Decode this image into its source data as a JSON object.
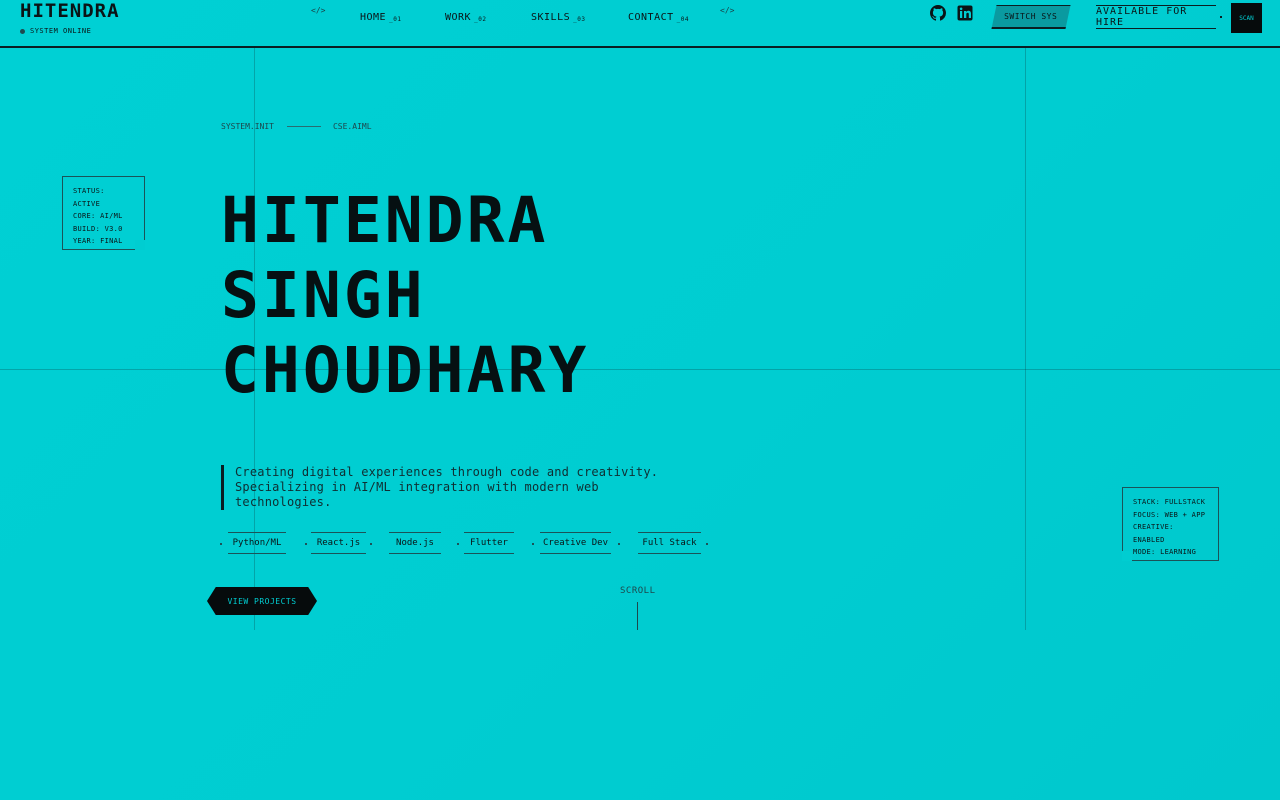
{
  "header": {
    "logo": "HITENDRA",
    "status": "SYSTEM ONLINE",
    "code_open": "</>",
    "code_close": "</>",
    "nav": [
      {
        "label": "HOME",
        "num": "_01"
      },
      {
        "label": "WORK",
        "num": "_02"
      },
      {
        "label": "SKILLS",
        "num": "_03"
      },
      {
        "label": "CONTACT",
        "num": "_04"
      }
    ],
    "social": [
      "github-icon",
      "linkedin-icon"
    ],
    "switch_label": "SWITCH SYS",
    "hire_label": "AVAILABLE FOR HIRE",
    "scan_label": "SCAN"
  },
  "hero": {
    "crumb_1": "SYSTEM.INIT",
    "crumb_2": "CSE.AIML",
    "name_line_1": "HITENDRA",
    "name_line_2": "SINGH",
    "name_line_3": "CHOUDHARY",
    "tagline_1": "Creating digital experiences through code and creativity.",
    "tagline_2": "Specializing in AI/ML integration with modern web",
    "tagline_3": "technologies.",
    "skills": [
      "Python/ML",
      "React.js",
      "Node.js",
      "Flutter",
      "Creative Dev",
      "Full Stack"
    ],
    "cta_label": "VIEW PROJECTS",
    "scroll_label": "SCROLL"
  },
  "info_left": [
    "STATUS: ACTIVE",
    "CORE: AI/ML",
    "BUILD: V3.0",
    "YEAR: FINAL"
  ],
  "info_right": [
    "STACK: FULLSTACK",
    "FOCUS: WEB + APP",
    "CREATIVE: ENABLED",
    "MODE: LEARNING"
  ],
  "colors": {
    "background": "#00cdd1",
    "ink": "#0a1416",
    "button": "#060b0c"
  }
}
